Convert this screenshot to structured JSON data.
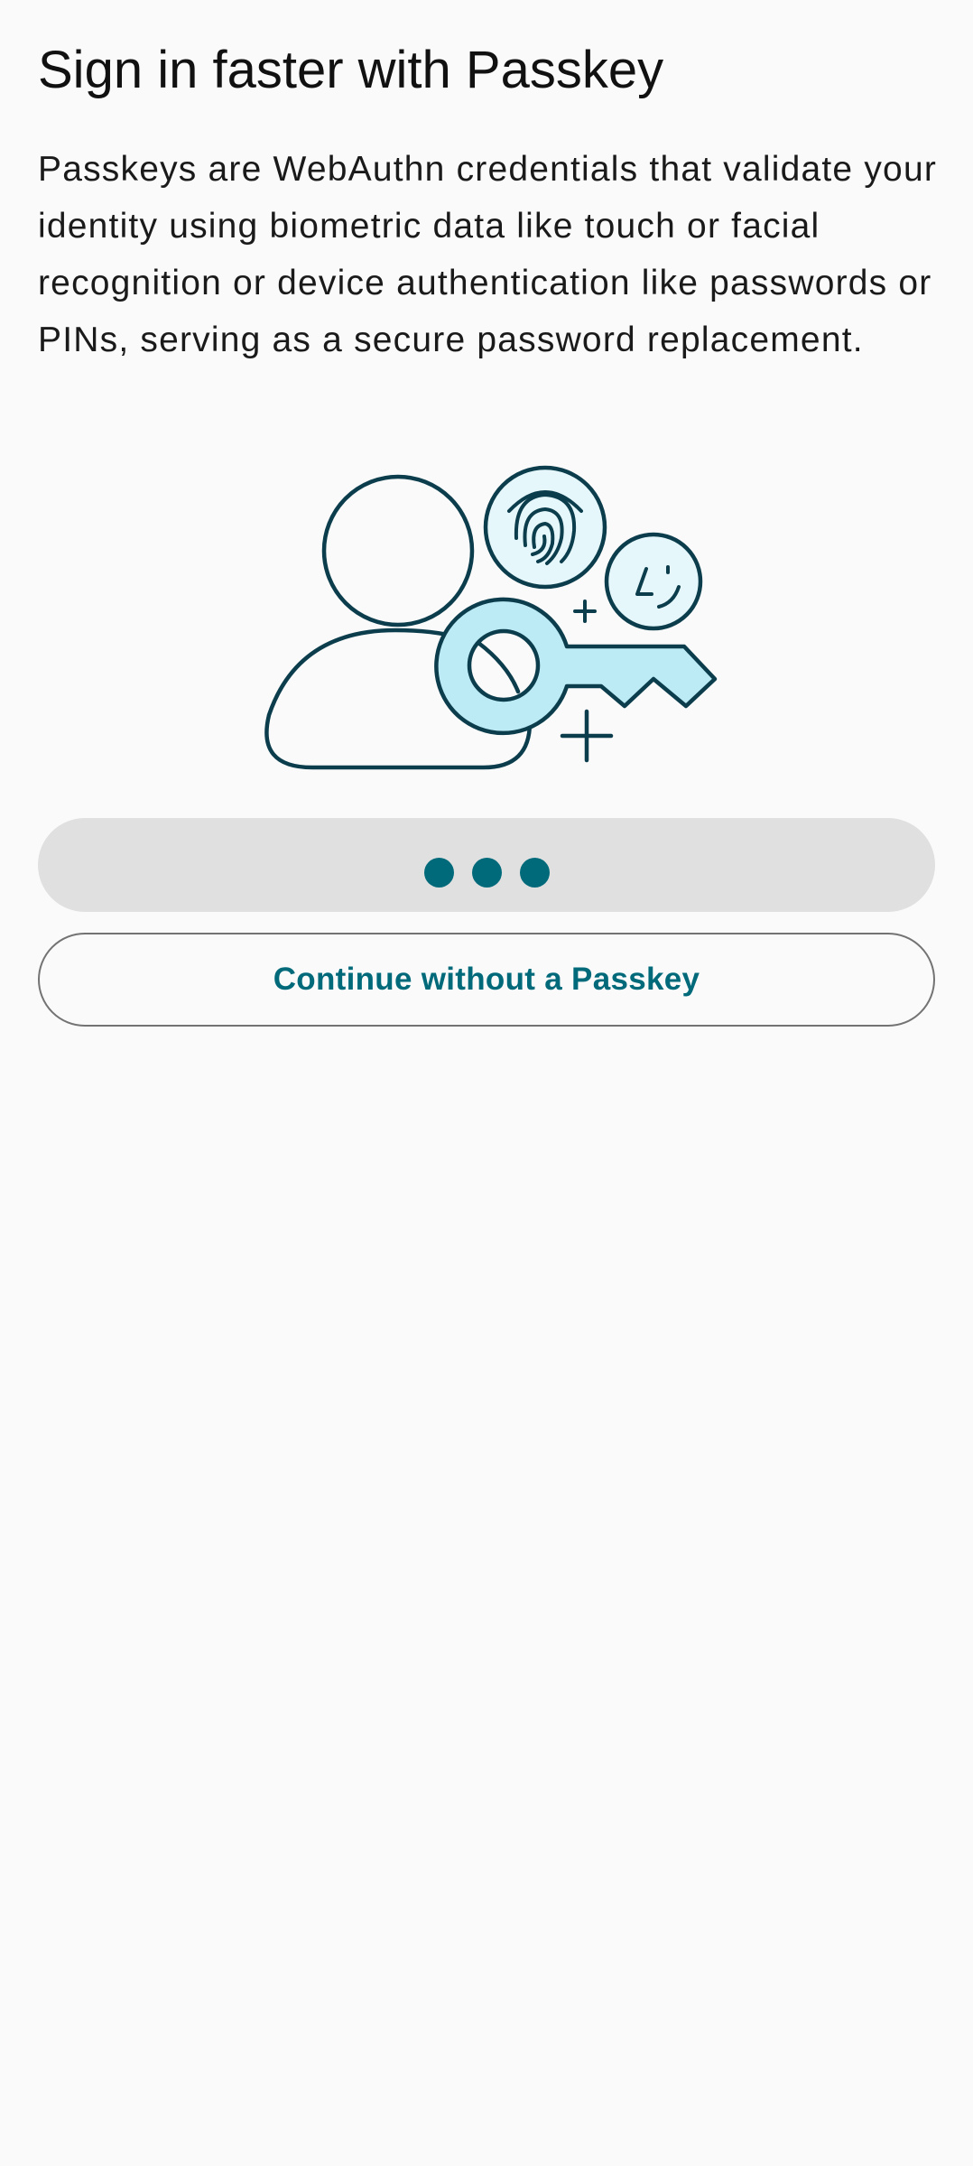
{
  "screen": {
    "title": "Sign in faster with Passkey",
    "description": "Passkeys are WebAuthn credentials that validate your identity using biometric data like touch or facial recognition or device authentication like passwords or PINs, serving as a secure password replacement."
  },
  "illustration": {
    "icons": [
      "person-icon",
      "fingerprint-icon",
      "face-icon",
      "key-icon",
      "plus-icon"
    ]
  },
  "actions": {
    "primary_state": "loading",
    "secondary_label": "Continue without a Passkey"
  },
  "colors": {
    "background": "#fafafa",
    "accent": "#006a7a",
    "illustration_stroke": "#0b3d4c",
    "illustration_fill": "#bdebf5",
    "loading_button_bg": "#e0e0e0",
    "outline_border": "#737373"
  }
}
